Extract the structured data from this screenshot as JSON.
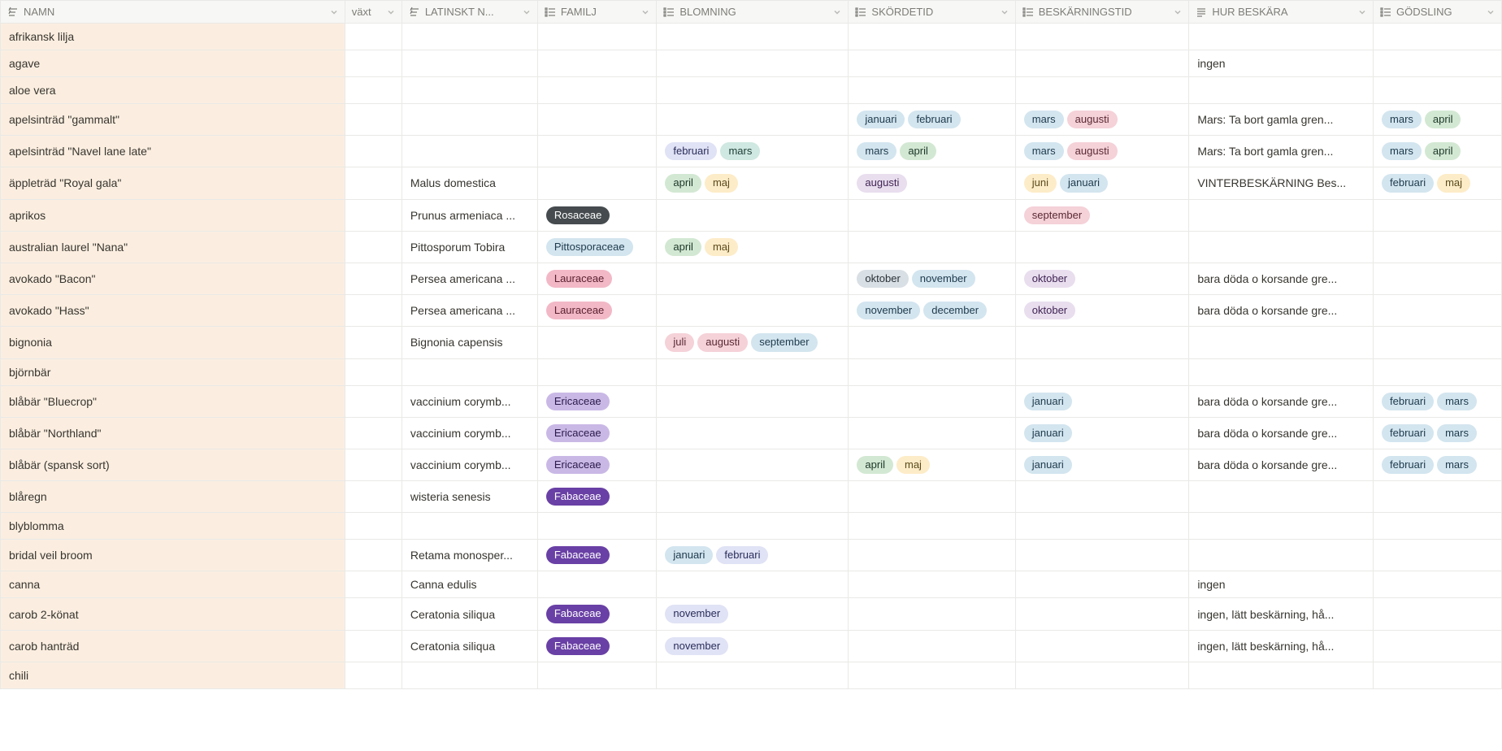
{
  "columns": {
    "namn": {
      "label": "NAMN",
      "icon": "text"
    },
    "vaxt": {
      "label": "växt",
      "icon": ""
    },
    "latinskt": {
      "label": "LATINSKT N...",
      "icon": "text"
    },
    "familj": {
      "label": "FAMILJ",
      "icon": "multiselect"
    },
    "blomning": {
      "label": "BLOMNING",
      "icon": "multiselect"
    },
    "skordetid": {
      "label": "SKÖRDETID",
      "icon": "multiselect"
    },
    "beskarningstid": {
      "label": "BESKÄRNINGSTID",
      "icon": "multiselect"
    },
    "hur": {
      "label": "HUR BESKÄRA",
      "icon": "textlong"
    },
    "godsling": {
      "label": "GÖDSLING",
      "icon": "multiselect"
    }
  },
  "tag_colors": {
    "januari": "blue-light",
    "februari": "blue-light",
    "mars": "teal-light",
    "april": "green-light",
    "maj": "yellow",
    "juni": "yellow",
    "juli": "pink-light",
    "augusti": "purple-light",
    "september": "peach",
    "oktober": "gray-blue",
    "november": "blue-light",
    "december": "blue-light",
    "Rosaceae": "gray-dark",
    "Pittosporaceae": "blue-light",
    "Lauraceae": "pink-med",
    "Ericaceae": "purple-med",
    "Fabaceae": "purple-dark"
  },
  "override_colors": {
    "blomning:augusti": "pink-light",
    "blomning:februari": "lavender",
    "blomning:september": "blue-light",
    "blomning:november": "lavender",
    "skordetid:augusti": "purple-light",
    "skordetid:mars": "blue-light",
    "beskarningstid:mars": "blue-light",
    "beskarningstid:augusti": "pink-light",
    "beskarningstid:januari": "blue-light",
    "beskarningstid:september": "pink-light",
    "beskarningstid:oktober": "purple-light",
    "godsling:mars": "blue-light",
    "godsling:april": "green-light",
    "godsling:februari": "blue-light",
    "godsling:maj": "yellow"
  },
  "rows": [
    {
      "namn": "afrikansk lilja"
    },
    {
      "namn": "agave",
      "hur": "ingen"
    },
    {
      "namn": "aloe vera"
    },
    {
      "namn": "apelsinträd \"gammalt\"",
      "skordetid": [
        "januari",
        "februari"
      ],
      "beskarningstid": [
        "mars",
        "augusti"
      ],
      "hur": "Mars: Ta bort gamla gren...",
      "godsling": [
        "mars",
        "april"
      ]
    },
    {
      "namn": "apelsinträd \"Navel lane late\"",
      "blomning": [
        "februari",
        "mars"
      ],
      "skordetid": [
        "mars",
        "april"
      ],
      "beskarningstid": [
        "mars",
        "augusti"
      ],
      "hur": "Mars: Ta bort gamla gren...",
      "godsling": [
        "mars",
        "april"
      ]
    },
    {
      "namn": "äppleträd \"Royal gala\"",
      "latinskt": "Malus domestica",
      "blomning": [
        "april",
        "maj"
      ],
      "skordetid": [
        "augusti"
      ],
      "beskarningstid": [
        "juni",
        "januari"
      ],
      "hur": "VINTERBESKÄRNING Bes...",
      "godsling": [
        "februari",
        "maj"
      ]
    },
    {
      "namn": "aprikos",
      "latinskt": "Prunus armeniaca ...",
      "familj": [
        "Rosaceae"
      ],
      "beskarningstid": [
        "september"
      ]
    },
    {
      "namn": "australian laurel \"Nana\"",
      "latinskt": "Pittosporum Tobira",
      "familj": [
        "Pittosporaceae"
      ],
      "blomning": [
        "april",
        "maj"
      ]
    },
    {
      "namn": "avokado \"Bacon\"",
      "latinskt": "Persea americana ...",
      "familj": [
        "Lauraceae"
      ],
      "skordetid": [
        "oktober",
        "november"
      ],
      "beskarningstid": [
        "oktober"
      ],
      "hur": "bara döda o korsande gre..."
    },
    {
      "namn": "avokado \"Hass\"",
      "latinskt": "Persea americana ...",
      "familj": [
        "Lauraceae"
      ],
      "skordetid": [
        "november",
        "december"
      ],
      "beskarningstid": [
        "oktober"
      ],
      "hur": "bara döda o korsande gre..."
    },
    {
      "namn": "bignonia",
      "latinskt": "Bignonia capensis",
      "blomning": [
        "juli",
        "augusti",
        "september"
      ]
    },
    {
      "namn": "björnbär"
    },
    {
      "namn": "blåbär \"Bluecrop\"",
      "latinskt": "vaccinium corymb...",
      "familj": [
        "Ericaceae"
      ],
      "beskarningstid": [
        "januari"
      ],
      "hur": "bara döda o korsande gre...",
      "godsling": [
        "februari",
        "mars"
      ]
    },
    {
      "namn": "blåbär \"Northland\"",
      "latinskt": "vaccinium corymb...",
      "familj": [
        "Ericaceae"
      ],
      "beskarningstid": [
        "januari"
      ],
      "hur": "bara döda o korsande gre...",
      "godsling": [
        "februari",
        "mars"
      ]
    },
    {
      "namn": "blåbär (spansk sort)",
      "latinskt": "vaccinium corymb...",
      "familj": [
        "Ericaceae"
      ],
      "skordetid": [
        "april",
        "maj"
      ],
      "beskarningstid": [
        "januari"
      ],
      "hur": "bara döda o korsande gre...",
      "godsling": [
        "februari",
        "mars"
      ]
    },
    {
      "namn": "blåregn",
      "latinskt": "wisteria senesis",
      "familj": [
        "Fabaceae"
      ]
    },
    {
      "namn": "blyblomma"
    },
    {
      "namn": "bridal veil broom",
      "latinskt": "Retama monosper...",
      "familj": [
        "Fabaceae"
      ],
      "blomning": [
        "januari",
        "februari"
      ]
    },
    {
      "namn": "canna",
      "latinskt": "Canna edulis",
      "hur": "ingen"
    },
    {
      "namn": "carob 2-könat",
      "latinskt": "Ceratonia siliqua",
      "familj": [
        "Fabaceae"
      ],
      "blomning": [
        "november"
      ],
      "hur": "ingen, lätt beskärning, hå..."
    },
    {
      "namn": "carob hanträd",
      "latinskt": "Ceratonia siliqua",
      "familj": [
        "Fabaceae"
      ],
      "blomning": [
        "november"
      ],
      "hur": "ingen, lätt beskärning, hå..."
    },
    {
      "namn": "chili"
    }
  ]
}
